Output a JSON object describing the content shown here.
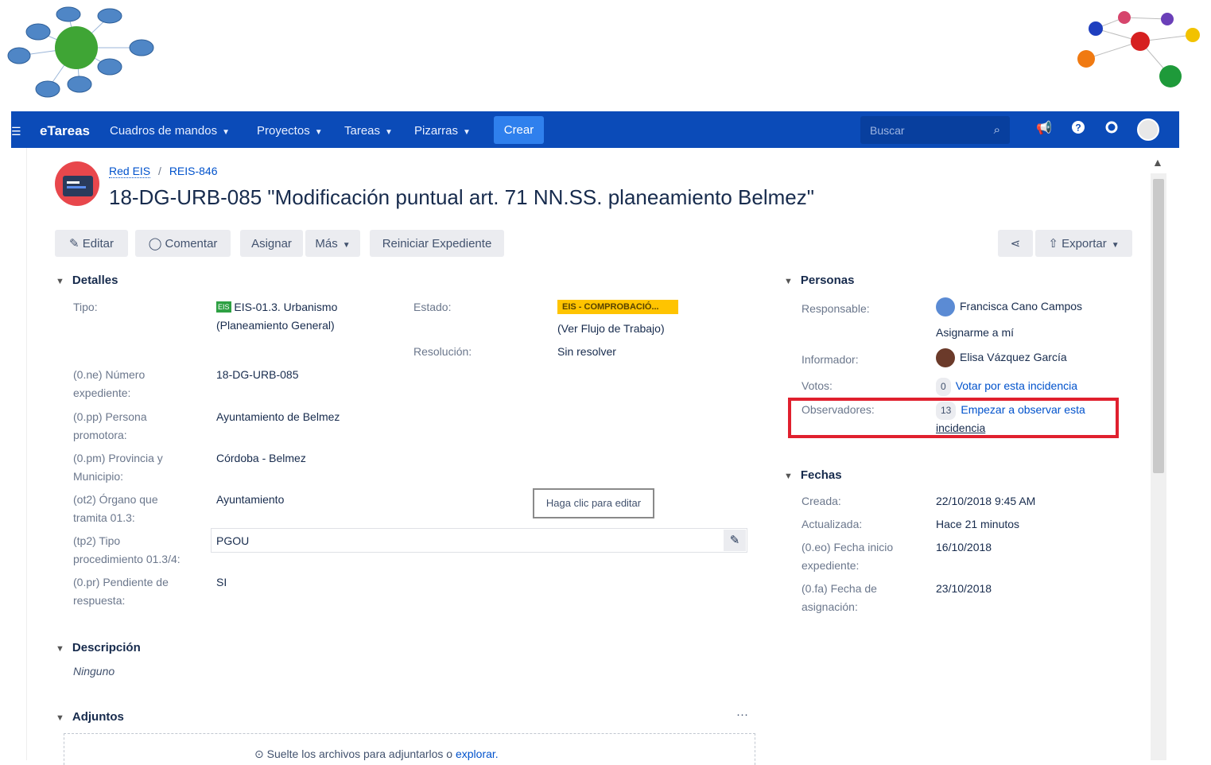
{
  "nav": {
    "brand": "eTareas",
    "menus": [
      "Cuadros de mandos",
      "Proyectos",
      "Tareas",
      "Pizarras"
    ],
    "create_label": "Crear",
    "search_placeholder": "Buscar"
  },
  "breadcrumb": {
    "project": "Red EIS",
    "separator": "/",
    "issue_key": "REIS-846"
  },
  "issue_title": "18-DG-URB-085 \"Modificación puntual art. 71 NN.SS. planeamiento Belmez\"",
  "toolbar": {
    "edit": "Editar",
    "comment": "Comentar",
    "assign": "Asignar",
    "more": "Más",
    "restart": "Reiniciar Expediente",
    "export": "Exportar"
  },
  "details": {
    "title": "Detalles",
    "type_label": "Tipo:",
    "type_icon_text": "EIS",
    "type_value_line1": "EIS-01.3. Urbanismo",
    "type_value_line2": "(Planeamiento General)",
    "status_label": "Estado:",
    "status_value": "EIS - COMPROBACIÓ...",
    "workflow_link": "(Ver Flujo de Trabajo)",
    "resolution_label": "Resolución:",
    "resolution_value": "Sin resolver",
    "fields": [
      {
        "label1": "(0.ne) Número",
        "label2": "expediente:",
        "value": "18-DG-URB-085"
      },
      {
        "label1": "(0.pp) Persona",
        "label2": "promotora:",
        "value": "Ayuntamiento de Belmez"
      },
      {
        "label1": "(0.pm) Provincia y",
        "label2": "Municipio:",
        "value": "Córdoba - Belmez"
      },
      {
        "label1": "(ot2) Órgano que",
        "label2": "tramita 01.3:",
        "value": "Ayuntamiento"
      },
      {
        "label1": "(tp2) Tipo",
        "label2": "procedimiento 01.3/4:",
        "value": "PGOU"
      },
      {
        "label1": "(0.pr) Pendiente de",
        "label2": "respuesta:",
        "value": "SI"
      }
    ],
    "tooltip": "Haga clic para editar"
  },
  "description": {
    "title": "Descripción",
    "value": "Ninguno"
  },
  "attachments": {
    "title": "Adjuntos",
    "more": "···",
    "drop_text": "Suelte los archivos para adjuntarlos o ",
    "browse": "explorar."
  },
  "people": {
    "title": "Personas",
    "assignee_label": "Responsable:",
    "assignee_name": "Francisca Cano Campos",
    "assign_me": "Asignarme a mí",
    "reporter_label": "Informador:",
    "reporter_name": "Elisa Vázquez García",
    "votes_label": "Votos:",
    "votes_count": "0",
    "vote_link": "Votar por esta incidencia",
    "watchers_label": "Observadores:",
    "watchers_count": "13",
    "watch_link_1": "Empezar a observar esta",
    "watch_link_2": "incidencia"
  },
  "dates": {
    "title": "Fechas",
    "created_label": "Creada:",
    "created_value": "22/10/2018 9:45 AM",
    "updated_label": "Actualizada:",
    "updated_value": "Hace 21 minutos",
    "start_label1": "(0.eo) Fecha inicio",
    "start_label2": "expediente:",
    "start_value": "16/10/2018",
    "assign_label1": "(0.fa) Fecha de",
    "assign_label2": "asignación:",
    "assign_value": "23/10/2018"
  },
  "colors": {
    "nav_bg": "#0b4bb8",
    "create_bg": "#2f80ed",
    "status_bg": "#ffc400",
    "highlight": "#e0202e"
  }
}
